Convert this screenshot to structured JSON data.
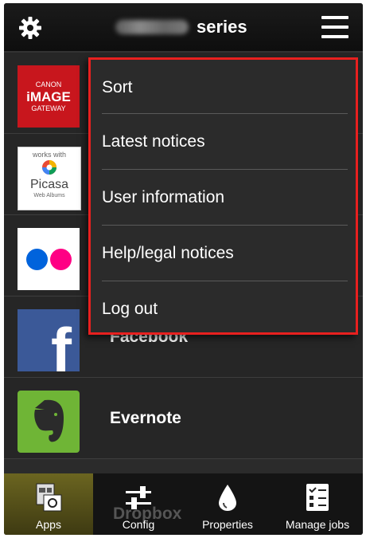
{
  "header": {
    "title_suffix": "series",
    "title_prefix_blurred": true
  },
  "apps": [
    {
      "name": "",
      "logo": {
        "line1": "CANON",
        "line2": "iMAGE",
        "line3": "GATEWAY"
      }
    },
    {
      "name": "",
      "logo": {
        "line1": "works with",
        "line2": "Picasa",
        "line3": "Web Albums"
      }
    },
    {
      "name": "",
      "logo": "flickr-logo"
    },
    {
      "name": "Facebook",
      "logo": "f"
    },
    {
      "name": "Evernote",
      "logo": "evernote-elephant"
    }
  ],
  "partial_row": {
    "name": "Dropbox"
  },
  "menu": {
    "items": [
      "Sort",
      "Latest notices",
      "User information",
      "Help/legal notices",
      "Log out"
    ],
    "highlight_color": "#e8201f"
  },
  "tabs": [
    {
      "label": "Apps",
      "icon": "apps-icon",
      "active": true
    },
    {
      "label": "Config",
      "icon": "sliders-icon",
      "active": false
    },
    {
      "label": "Properties",
      "icon": "ink-drop-icon",
      "active": false
    },
    {
      "label": "Manage jobs",
      "icon": "job-list-icon",
      "active": false
    }
  ],
  "colors": {
    "flickr_blue": "#0063dc",
    "flickr_pink": "#ff0084",
    "facebook": "#3b5998",
    "evernote": "#6fb536",
    "canon": "#c8161d"
  }
}
